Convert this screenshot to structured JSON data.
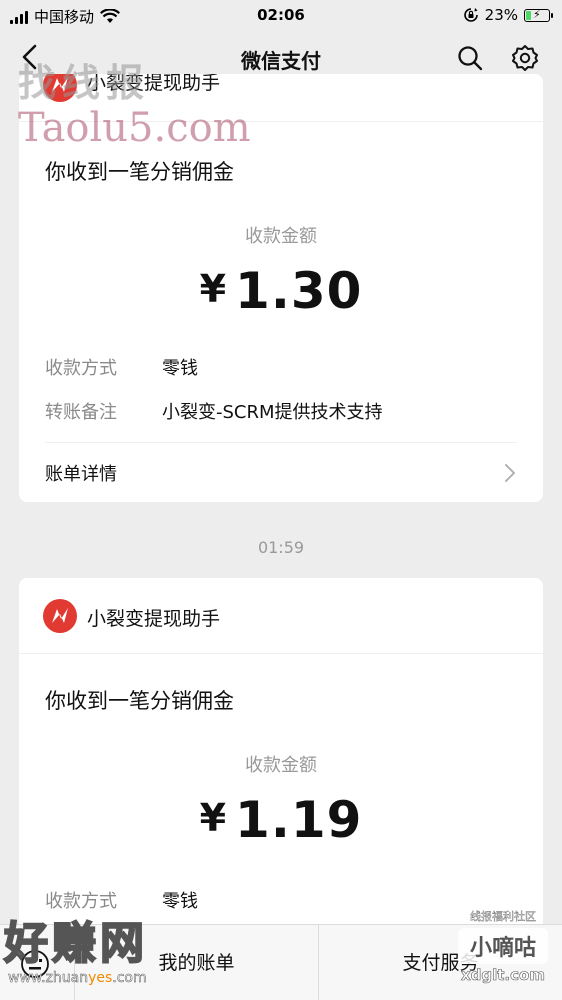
{
  "status_bar": {
    "carrier": "中国移动",
    "time": "02:06",
    "battery_percent": "23%",
    "battery_level": 0.23
  },
  "nav": {
    "title": "微信支付"
  },
  "watermarks": {
    "top_cn": "找线报",
    "top_en": "Taolu5.com",
    "bottom_left": "好赚网",
    "bottom_left_url_a": "www.zhuan",
    "bottom_left_url_b": "yes",
    "bottom_left_url_c": ".com",
    "bottom_right_small": "线报福利社区",
    "bottom_right_box": "小嘀咕",
    "bottom_right_domain": "xdglt.com"
  },
  "messages": [
    {
      "brand": "小裂变提现助手",
      "title": "你收到一笔分销佣金",
      "amount_label": "收款金额",
      "currency": "¥",
      "amount": "1.30",
      "method_key": "收款方式",
      "method_value": "零钱",
      "note_key": "转账备注",
      "note_value": "小裂变-SCRM提供技术支持",
      "detail": "账单详情"
    },
    {
      "brand": "小裂变提现助手",
      "title": "你收到一笔分销佣金",
      "amount_label": "收款金额",
      "currency": "¥",
      "amount": "1.19",
      "method_key": "收款方式",
      "method_value": "零钱"
    }
  ],
  "timestamp": "01:59",
  "tab_bar": {
    "items": [
      "我的账单",
      "支付服务"
    ]
  },
  "icons": {
    "back": "chevron-left-icon",
    "search": "search-icon",
    "settings": "gear-icon",
    "keyboard": "keyboard-icon",
    "wifi": "wifi-icon",
    "lock_rotation": "orientation-lock-icon"
  },
  "colors": {
    "background": "#ededed",
    "brand_red": "#e03a32",
    "muted_text": "#999999"
  }
}
